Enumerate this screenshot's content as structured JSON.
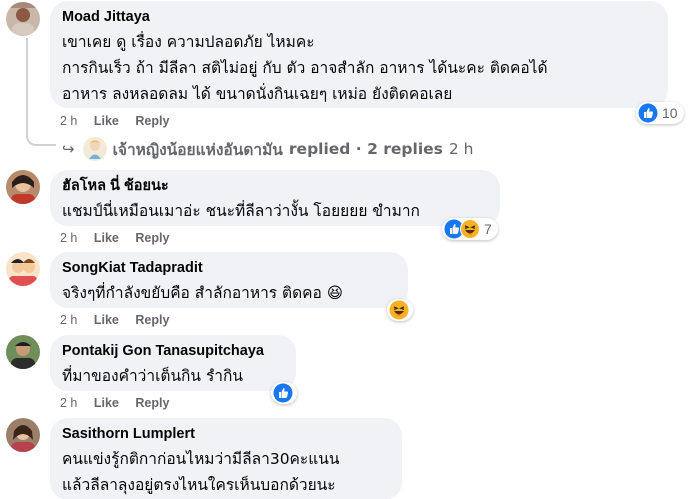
{
  "comments": [
    {
      "author": "Moad Jittaya",
      "lines": [
        "เขาเคย ดู เรื่อง ความปลอดภัย ไหมคะ",
        "การกินเร็ว ถ้า มีลีลา สติไม่อยู่ กับ ตัว อาจสำลัก อาหาร ได้นะคะ ติดคอได้",
        "อาหาร ลงหลอดลม ได้ ขนาดนั่งกินเฉยๆ เหม่อ ยังติดคอเลย"
      ],
      "time": "2 h",
      "like": "Like",
      "reply": "Reply",
      "reaction_count": "10",
      "reactions": [
        "like-icon"
      ]
    },
    {
      "author": "ฮัลโหล นี่ ช้อยนะ",
      "lines": [
        "แชมป์นี่เหมือนเมาอ่ะ ชนะที่ลีลาว่างั้น โอยยยย ขำมาก"
      ],
      "time": "2 h",
      "like": "Like",
      "reply": "Reply",
      "reaction_count": "7",
      "reactions": [
        "like-icon",
        "haha-icon"
      ]
    },
    {
      "author": "SongKiat Tadapradit",
      "lines": [
        "จริงๆที่กำลังขยับคือ สำลักอาหาร ติดคอ 😆"
      ],
      "time": "2 h",
      "like": "Like",
      "reply": "Reply",
      "reaction_count": "",
      "reactions": [
        "haha-icon"
      ]
    },
    {
      "author": "Pontakij Gon Tanasupitchaya",
      "lines": [
        "ที่มาของคำว่าเต็นกิน รำกิน"
      ],
      "time": "2 h",
      "like": "Like",
      "reply": "Reply",
      "reaction_count": "",
      "reactions": [
        "like-icon"
      ]
    },
    {
      "author": "Sasithorn Lumplert",
      "lines": [
        "คนแข่งรู้กติกาก่อนไหมว่ามีลีลา30คะแนน",
        "แล้วลีลาลุงอยู่ตรงไหนใครเห็นบอกด้วยนะ"
      ]
    }
  ],
  "replies_summary": {
    "author": "เจ้าหญิงน้อยแห่งอันดามัน",
    "text": "replied · 2 replies",
    "time": "2 h"
  },
  "colors": {
    "bubble": "#f0f2f5",
    "like_blue": "#1877f2",
    "haha_yellow": "#f7b125",
    "meta_gray": "#65676b"
  }
}
